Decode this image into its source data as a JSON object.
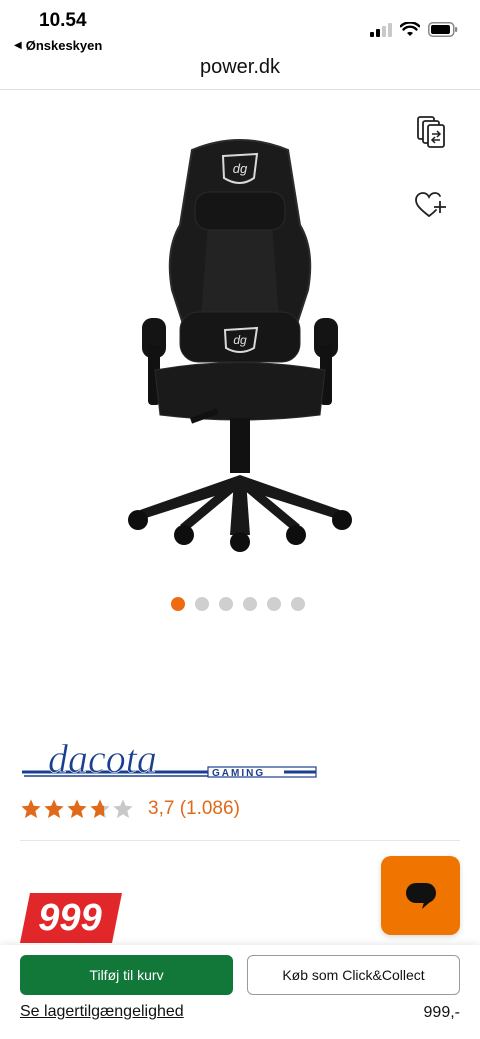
{
  "status_bar": {
    "time": "10.54",
    "back_label": "Ønskeskyen"
  },
  "browser": {
    "url": "power.dk"
  },
  "product": {
    "image_icon": "gaming-chair-image",
    "carousel": {
      "total": 6,
      "active_index": 0
    },
    "brand_logo_text": "dacota",
    "brand_logo_subtext": "GAMING",
    "rating": {
      "stars_value": 3.7,
      "stars_max": 5,
      "label": "3,7 (1.086)"
    },
    "price_badge": "999"
  },
  "actions": {
    "add_to_cart": "Tilføj til kurv",
    "click_collect": "Køb som Click&Collect",
    "stock_link": "Se lagertilgængelighed",
    "price": "999,-"
  },
  "colors": {
    "accent_orange": "#ee6b10",
    "price_red": "#e2272b",
    "cart_green": "#12783a",
    "brand_blue": "#1a3f8f"
  },
  "icons": {
    "compare": "compare-icon",
    "wishlist": "heart-plus-icon",
    "chat": "chat-bubble-icon"
  }
}
